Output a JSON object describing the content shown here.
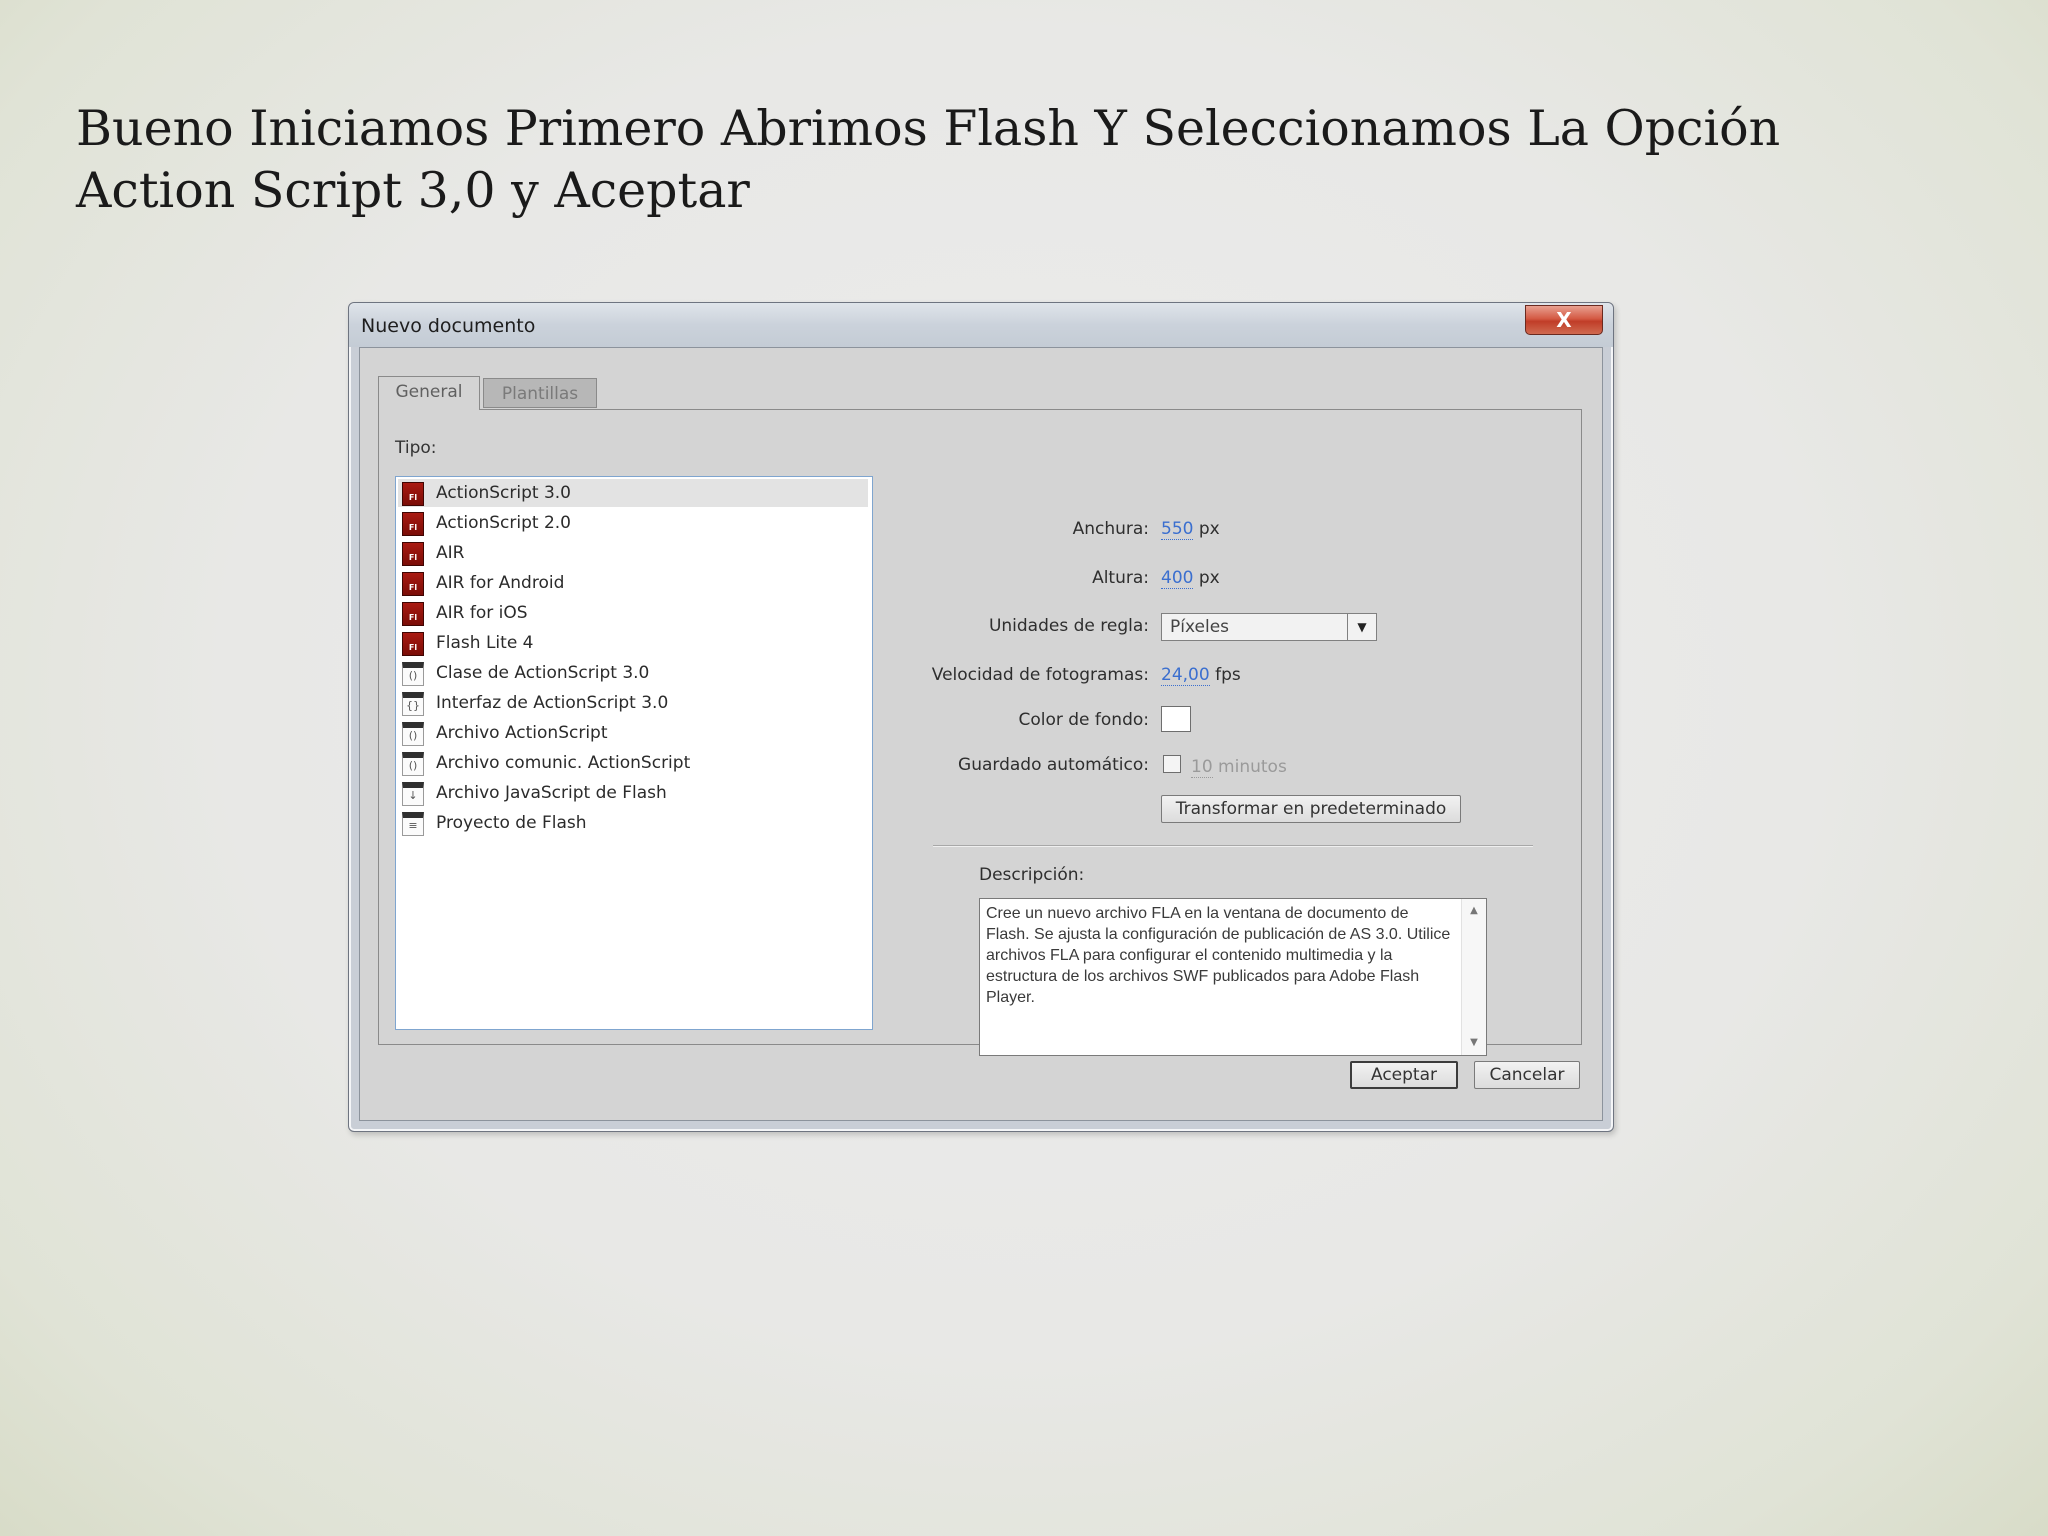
{
  "slide": {
    "title": "Bueno Iniciamos Primero Abrimos Flash Y Seleccionamos La Opción Action Script 3,0 y Aceptar"
  },
  "dialog": {
    "title": "Nuevo documento",
    "close_label": "X",
    "tabs": [
      {
        "label": "General",
        "active": true
      },
      {
        "label": "Plantillas",
        "active": false
      }
    ],
    "tipo_label": "Tipo:",
    "types": [
      {
        "label": "ActionScript 3.0",
        "icon": "flash-fla-icon",
        "selected": true
      },
      {
        "label": "ActionScript 2.0",
        "icon": "flash-fla-icon",
        "selected": false
      },
      {
        "label": "AIR",
        "icon": "flash-fla-icon",
        "selected": false
      },
      {
        "label": "AIR for Android",
        "icon": "flash-fla-icon",
        "selected": false
      },
      {
        "label": "AIR for iOS",
        "icon": "flash-fla-icon",
        "selected": false
      },
      {
        "label": "Flash Lite 4",
        "icon": "flash-fla-icon",
        "selected": false
      },
      {
        "label": "Clase de ActionScript 3.0",
        "icon": "as-class-file-icon",
        "selected": false
      },
      {
        "label": "Interfaz de ActionScript 3.0",
        "icon": "as-interface-file-icon",
        "selected": false
      },
      {
        "label": "Archivo ActionScript",
        "icon": "as-file-icon",
        "selected": false
      },
      {
        "label": "Archivo comunic. ActionScript",
        "icon": "as-comm-file-icon",
        "selected": false
      },
      {
        "label": "Archivo JavaScript de Flash",
        "icon": "jsfl-file-icon",
        "selected": false
      },
      {
        "label": "Proyecto de Flash",
        "icon": "flash-project-icon",
        "selected": false
      }
    ],
    "settings": {
      "width_label": "Anchura:",
      "width_value": "550",
      "width_unit": "px",
      "height_label": "Altura:",
      "height_value": "400",
      "height_unit": "px",
      "ruler_label": "Unidades de regla:",
      "ruler_value": "Píxeles",
      "fps_label": "Velocidad de fotogramas:",
      "fps_value": "24,00",
      "fps_unit": "fps",
      "bg_label": "Color de fondo:",
      "bg_color": "#ffffff",
      "autosave_label": "Guardado automático:",
      "autosave_checked": false,
      "autosave_value": "10",
      "autosave_unit": "minutos",
      "make_default_label": "Transformar en predeterminado"
    },
    "description_label": "Descripción:",
    "description_text": "Cree un nuevo archivo FLA en la ventana de documento de Flash. Se ajusta la configuración de publicación de AS 3.0. Utilice archivos FLA para configurar el contenido multimedia y la estructura de los archivos SWF publicados para Adobe Flash Player.",
    "ok_label": "Aceptar",
    "cancel_label": "Cancelar"
  }
}
